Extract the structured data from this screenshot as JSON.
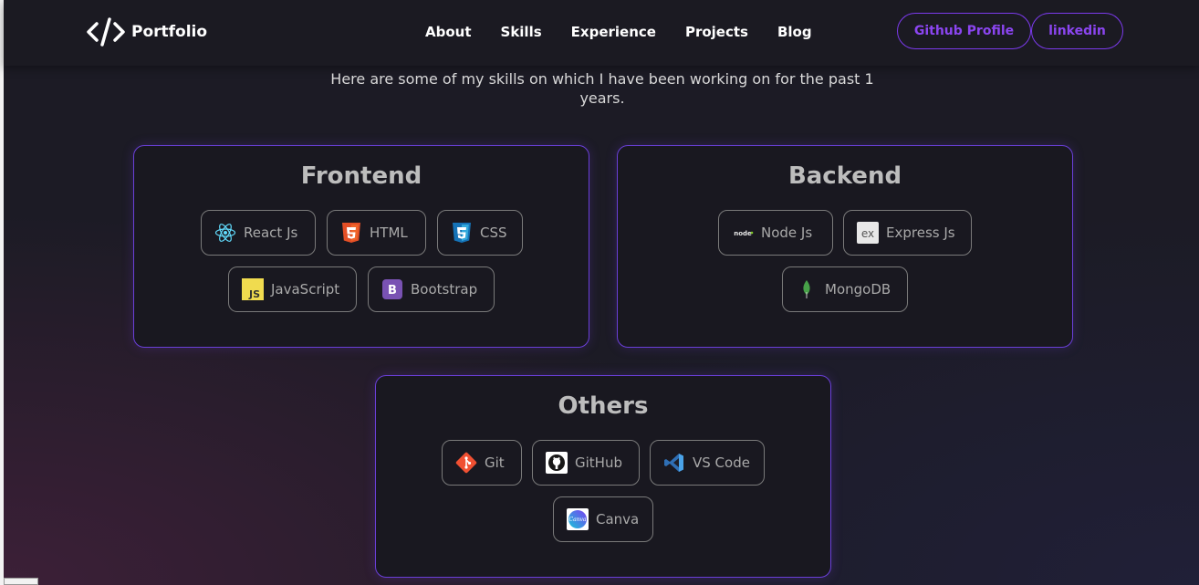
{
  "nav": {
    "logo_text": "Portfolio",
    "links": [
      "About",
      "Skills",
      "Experience",
      "Projects",
      "Blog"
    ],
    "github_button": "Github Profile",
    "linkedin_button": "linkedin"
  },
  "intro": "Here are some of my skills on which I have been working on for the past 1 years.",
  "cards": {
    "frontend": {
      "title": "Frontend",
      "skills": [
        "React Js",
        "HTML",
        "CSS",
        "JavaScript",
        "Bootstrap"
      ]
    },
    "backend": {
      "title": "Backend",
      "skills": [
        "Node Js",
        "Express Js",
        "MongoDB"
      ]
    },
    "others": {
      "title": "Others",
      "skills": [
        "Git",
        "GitHub",
        "VS Code",
        "Canva"
      ]
    }
  },
  "icons": {
    "react": "react-icon",
    "html": "html5-icon",
    "css": "css3-icon",
    "js": "javascript-icon",
    "bootstrap": "bootstrap-icon",
    "node": "nodejs-icon",
    "express": "express-icon",
    "mongodb": "mongodb-icon",
    "git": "git-icon",
    "github": "github-icon",
    "vscode": "vscode-icon",
    "canva": "canva-icon"
  },
  "colors": {
    "accent": "#7c3aed",
    "background": "#1c1b25",
    "card_border": "#6a3fd8"
  }
}
